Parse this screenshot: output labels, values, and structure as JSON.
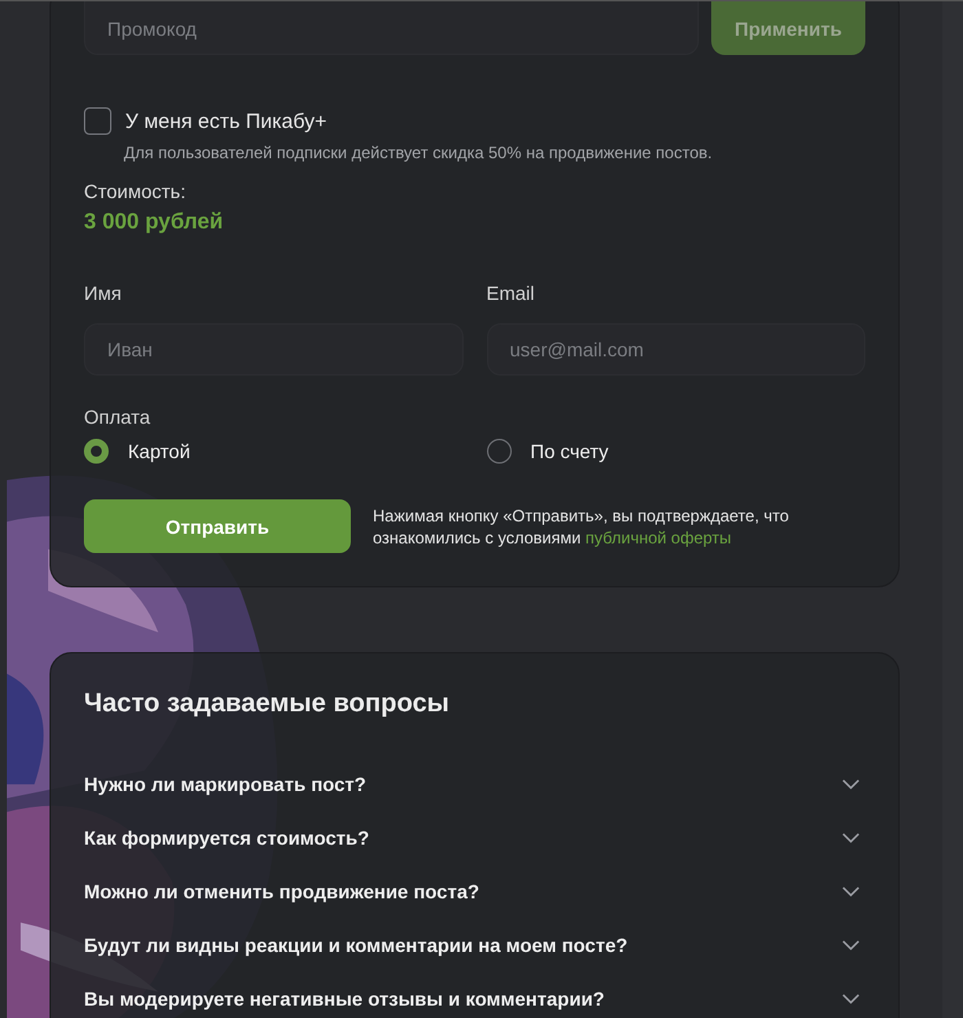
{
  "promo": {
    "placeholder": "Промокод",
    "button": "Применить"
  },
  "subscription": {
    "label": "У меня есть Пикабу+",
    "checked": false,
    "hint": "Для пользователей подписки действует скидка 50% на продвижение постов."
  },
  "cost": {
    "label": "Стоимость:",
    "value": "3 000 рублей"
  },
  "fields": [
    {
      "label": "Имя",
      "placeholder": "Иван"
    },
    {
      "label": "Email",
      "placeholder": "user@mail.com"
    }
  ],
  "payment": {
    "label": "Оплата",
    "options": [
      {
        "label": "Картой",
        "selected": true
      },
      {
        "label": "По счету",
        "selected": false
      }
    ]
  },
  "submit": {
    "button": "Отправить",
    "note": "Нажимая кнопку «Отправить», вы подтверждаете, что ознакомились с условиями ",
    "link": "публичной оферты"
  },
  "faq": {
    "title": "Часто задаваемые вопросы",
    "items": [
      {
        "question": "Нужно ли маркировать пост?",
        "expanded": false
      },
      {
        "question": "Как формируется стоимость?",
        "expanded": false
      },
      {
        "question": "Можно ли отменить продвижение поста?",
        "expanded": false
      },
      {
        "question": "Будут ли видны реакции и комментарии на моем посте?",
        "expanded": false
      },
      {
        "question": "Вы модерируете негативные отзывы и комментарии?",
        "expanded": false
      }
    ]
  }
}
